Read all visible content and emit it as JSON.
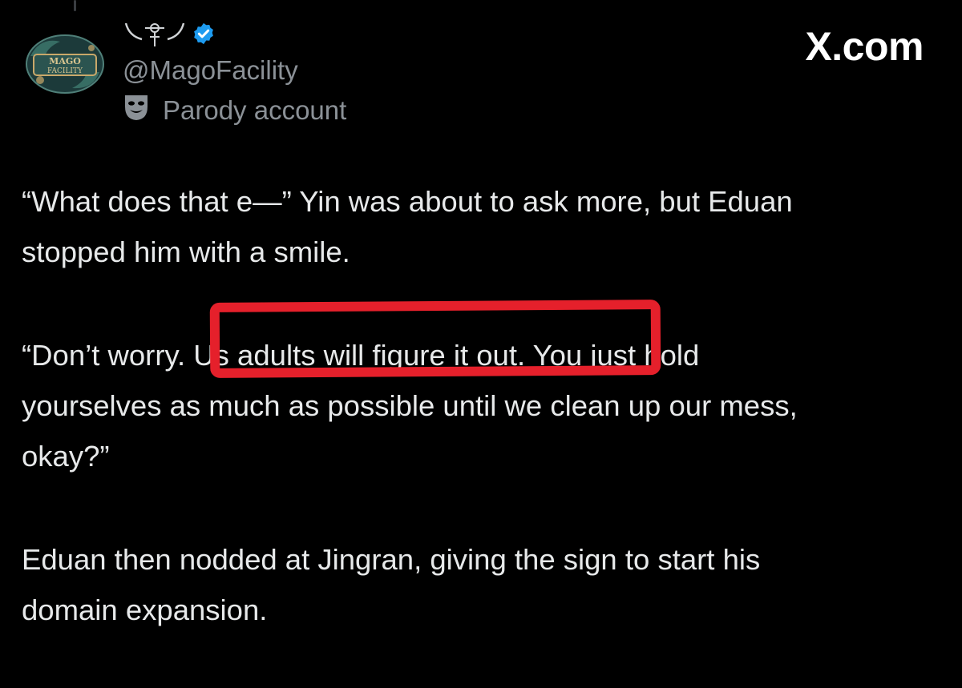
{
  "post": {
    "display_name_icon": "ornament-emblem-icon",
    "verified_badge_color": "#1d9bf0",
    "handle": "@MagoFacility",
    "label": "Parody account",
    "label_icon": "theater-mask-icon"
  },
  "watermark": "X.com",
  "paragraphs": [
    {
      "lines": [
        "“What does that e—” Yin was about to ask more, but Eduan",
        "stopped him with a smile."
      ]
    },
    {
      "lines": [
        "“Don’t worry. Us adults will figure it out. You just hold",
        "yourselves as much as possible until we clean up our mess,",
        "okay?”"
      ]
    },
    {
      "lines": [
        "Eduan then nodded at Jingran, giving the sign to start his",
        "domain expansion."
      ]
    }
  ],
  "annotation": {
    "color": "#e5202b",
    "highlighted_text": "Us adults will figure it out."
  }
}
